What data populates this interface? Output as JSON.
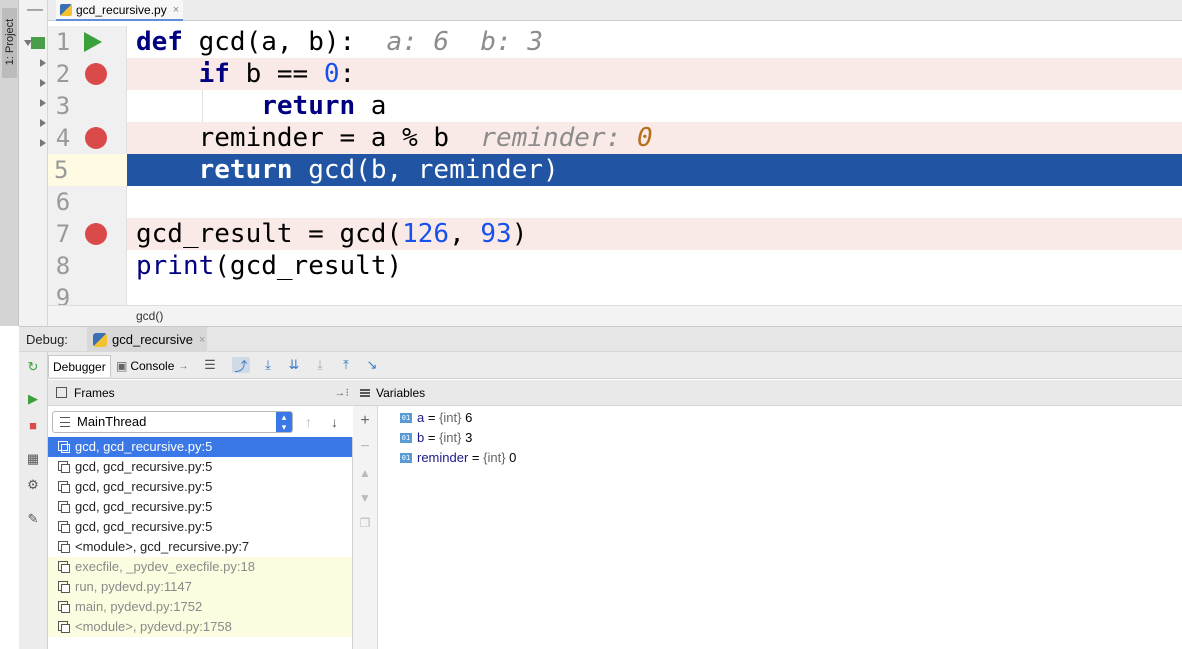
{
  "project_stripe": {
    "label": "1: Project"
  },
  "editor": {
    "tab": {
      "filename": "gcd_recursive.py",
      "close": "×"
    },
    "lines": [
      {
        "num": "1",
        "code": [
          "def",
          " gcd(a, b):  ",
          "a: 6  b: 3"
        ]
      },
      {
        "num": "2",
        "code": [
          "if",
          " b == ",
          "0",
          ":"
        ]
      },
      {
        "num": "3",
        "code": [
          "return",
          " a"
        ]
      },
      {
        "num": "4",
        "code": [
          "reminder = a % b  ",
          "reminder: ",
          "0"
        ]
      },
      {
        "num": "5",
        "code": [
          "return",
          " gcd(b, reminder)"
        ]
      },
      {
        "num": "6",
        "code": []
      },
      {
        "num": "7",
        "code": [
          "gcd_result = gcd(",
          "126",
          ", ",
          "93",
          ")"
        ]
      },
      {
        "num": "8",
        "code": [
          "print",
          "(gcd_result)"
        ]
      },
      {
        "num": "9",
        "code": []
      }
    ],
    "breadcrumb": "gcd()"
  },
  "debug": {
    "label": "Debug:",
    "session_tab": "gcd_recursive",
    "close": "×",
    "tabs": {
      "debugger": "Debugger",
      "console": "Console"
    },
    "frames": {
      "header": "Frames",
      "thread": "MainThread",
      "items": [
        {
          "text": "gcd, gcd_recursive.py:5",
          "kind": "selected"
        },
        {
          "text": "gcd, gcd_recursive.py:5",
          "kind": "user"
        },
        {
          "text": "gcd, gcd_recursive.py:5",
          "kind": "user"
        },
        {
          "text": "gcd, gcd_recursive.py:5",
          "kind": "user"
        },
        {
          "text": "gcd, gcd_recursive.py:5",
          "kind": "user"
        },
        {
          "text": "<module>, gcd_recursive.py:7",
          "kind": "user"
        },
        {
          "text": "execfile, _pydev_execfile.py:18",
          "kind": "lib"
        },
        {
          "text": "run, pydevd.py:1147",
          "kind": "lib"
        },
        {
          "text": "main, pydevd.py:1752",
          "kind": "lib"
        },
        {
          "text": "<module>, pydevd.py:1758",
          "kind": "lib"
        }
      ]
    },
    "variables": {
      "header": "Variables",
      "items": [
        {
          "name": "a",
          "eq": " = ",
          "type": "{int}",
          "value": " 6"
        },
        {
          "name": "b",
          "eq": " = ",
          "type": "{int}",
          "value": " 3"
        },
        {
          "name": "reminder",
          "eq": " = ",
          "type": "{int}",
          "value": " 0"
        }
      ]
    }
  }
}
